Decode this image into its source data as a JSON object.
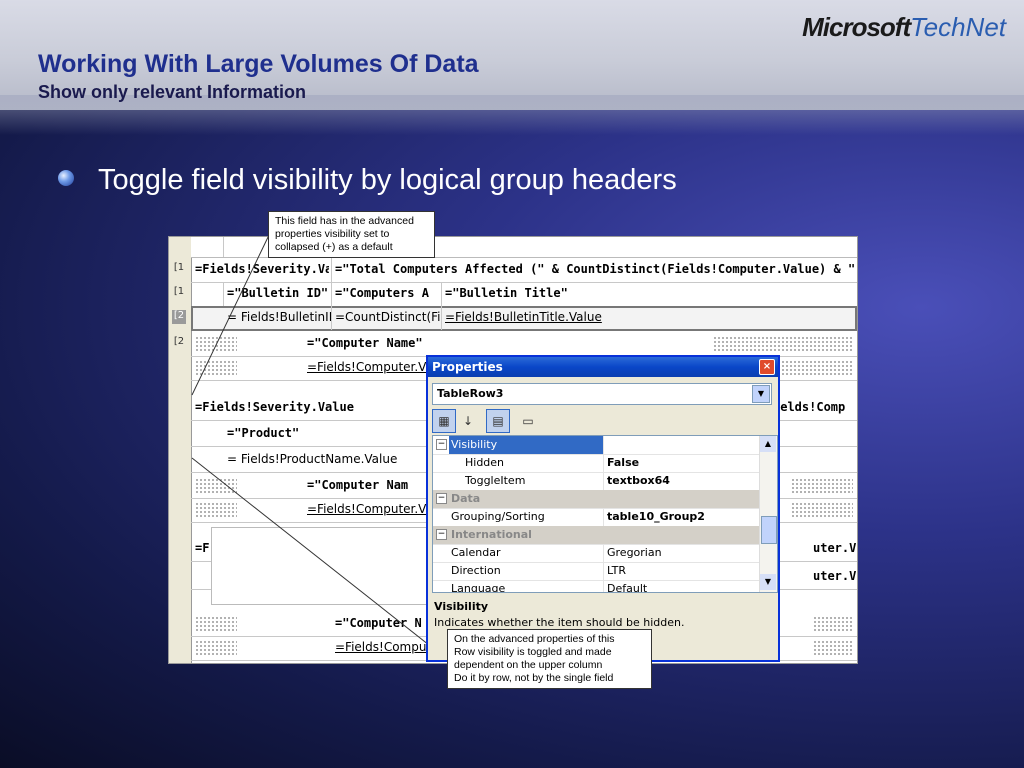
{
  "header": {
    "title": "Working With Large Volumes Of Data",
    "subtitle": "Show only relevant Information",
    "logo_ms": "Microsoft",
    "logo_tn": "TechNet"
  },
  "bullet": {
    "text": "Toggle field visibility by logical group headers"
  },
  "callouts": {
    "top": [
      "This field has in the advanced",
      "properties visibility set to",
      "collapsed (+) as a default"
    ],
    "bottom": [
      "On the advanced properties of this",
      "Row visibility is toggled and made",
      "dependent on the upper column",
      "Do it by row, not by the single field"
    ]
  },
  "designer": {
    "row1": {
      "c1": "=Fields!Severity.Va",
      "c2": "=\"Total Computers Affected (\" & CountDistinct(Fields!Computer.Value) & \")\""
    },
    "row2": {
      "c1": "=\"Bulletin ID\"",
      "c2": "=\"Computers A",
      "c3": "=\"Bulletin Title\""
    },
    "row3": {
      "c1": "= Fields!BulletinID",
      "c2": "=CountDistinct(Fi",
      "c3": "=Fields!BulletinTitle.Value"
    },
    "row4": {
      "c1": "=\"Computer Name\""
    },
    "row5": {
      "c1": "=Fields!Computer.V"
    },
    "row6": {
      "c1": "=Fields!Severity.Value",
      "c2": "ields!Comp"
    },
    "row7": {
      "c1": "=\"Product\""
    },
    "row8": {
      "c1": "= Fields!ProductName.Value"
    },
    "row9": {
      "c1": "=\"Computer Nam"
    },
    "row10": {
      "c1": "=Fields!Computer.V"
    },
    "row11": {
      "c1": "=F",
      "c2": "uter.V"
    },
    "row12": {
      "c1": "uter.V"
    },
    "row13": {
      "c1": "=\"Computer N"
    },
    "row14": {
      "c1": "=Fields!Compu"
    }
  },
  "properties": {
    "title": "Properties",
    "close": "×",
    "object": "TableRow3",
    "rows": [
      {
        "name": "Visibility",
        "value": "",
        "kind": "selected"
      },
      {
        "name": "Hidden",
        "value": "False",
        "kind": "sub"
      },
      {
        "name": "ToggleItem",
        "value": "textbox64",
        "kind": "sub"
      },
      {
        "name": "Data",
        "value": "",
        "kind": "category"
      },
      {
        "name": "Grouping/Sorting",
        "value": "table10_Group2",
        "kind": "prop"
      },
      {
        "name": "International",
        "value": "",
        "kind": "category"
      },
      {
        "name": "Calendar",
        "value": "Gregorian",
        "kind": "prop"
      },
      {
        "name": "Direction",
        "value": "LTR",
        "kind": "prop"
      },
      {
        "name": "Language",
        "value": "Default",
        "kind": "prop"
      }
    ],
    "desc_title": "Visibility",
    "desc_text": "Indicates whether the item should be hidden."
  }
}
